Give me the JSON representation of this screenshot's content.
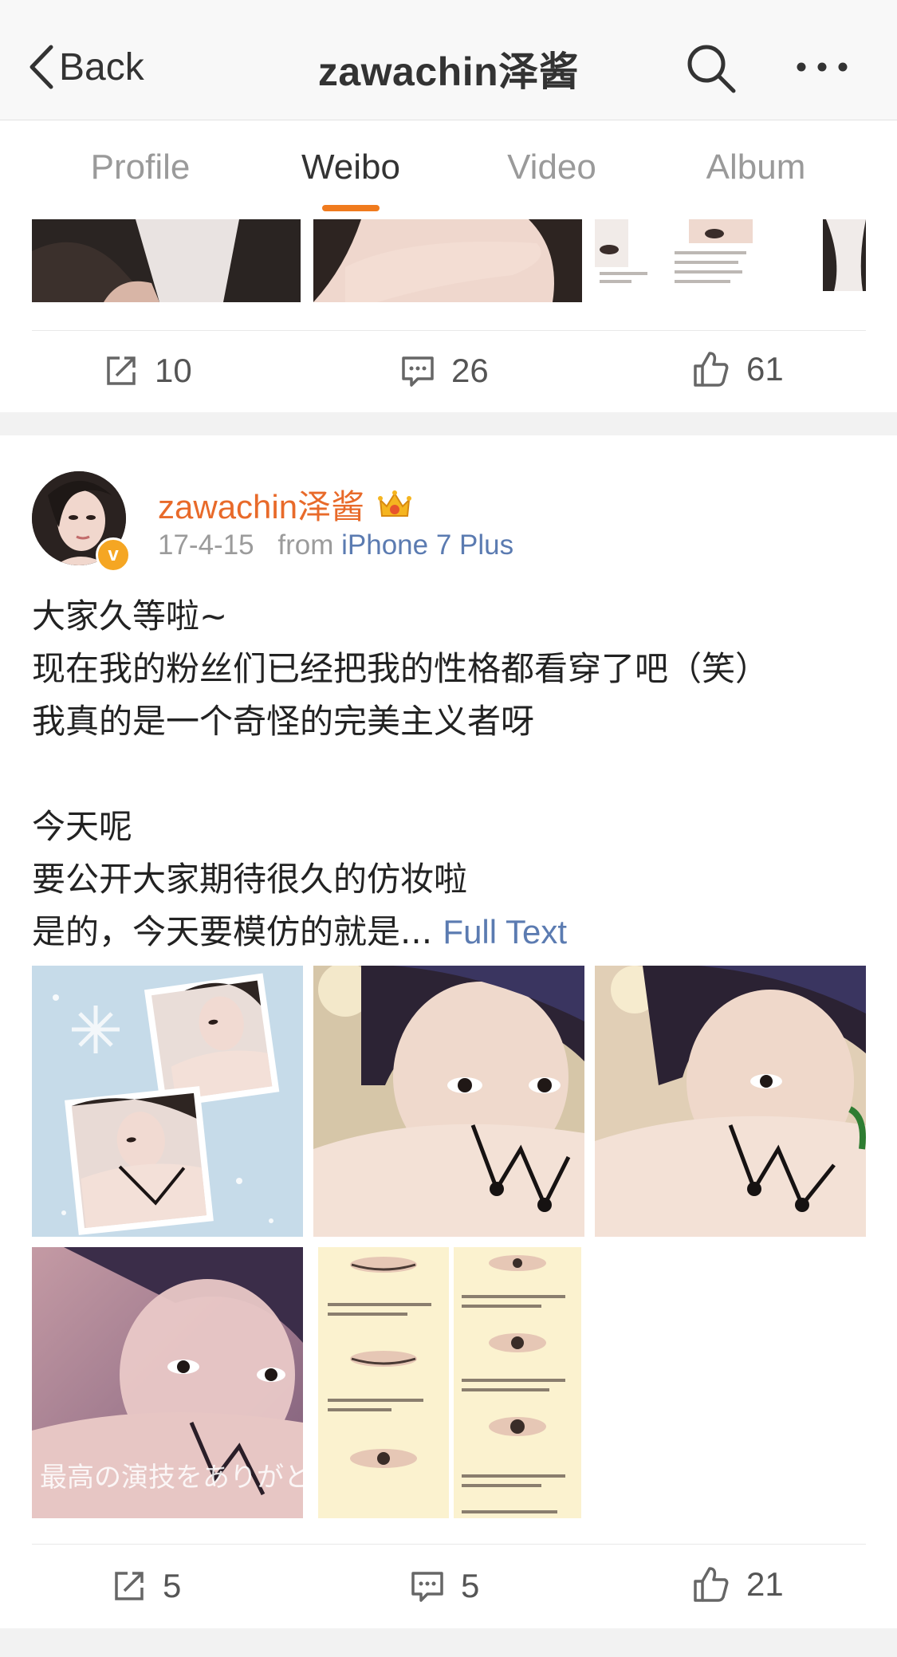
{
  "nav": {
    "back_label": "Back",
    "title": "zawachin泽酱",
    "search_icon": "search-icon",
    "more_icon": "more-icon"
  },
  "tabs": [
    {
      "label": "Profile",
      "active": false
    },
    {
      "label": "Weibo",
      "active": true
    },
    {
      "label": "Video",
      "active": false
    },
    {
      "label": "Album",
      "active": false
    }
  ],
  "post1": {
    "actions": {
      "repost": "10",
      "comment": "26",
      "like": "61"
    }
  },
  "post2": {
    "username": "zawachin泽酱",
    "date": "17-4-15",
    "from_label": "from",
    "source": "iPhone 7 Plus",
    "lines": [
      "大家久等啦~",
      "现在我的粉丝们已经把我的性格都看穿了吧（笑）",
      "我真的是一个奇怪的完美主义者呀",
      "",
      "今天呢",
      "要公开大家期待很久的仿妆啦",
      "是的，今天要模仿的就是..."
    ],
    "full_text_link": "Full Text",
    "image_caption": "最高の演技をありがとう",
    "actions": {
      "repost": "5",
      "comment": "5",
      "like": "21"
    }
  },
  "colors": {
    "accent": "#f07b1e",
    "username": "#e86a2a",
    "link": "#5b7bb1",
    "verified": "#f5a623"
  }
}
